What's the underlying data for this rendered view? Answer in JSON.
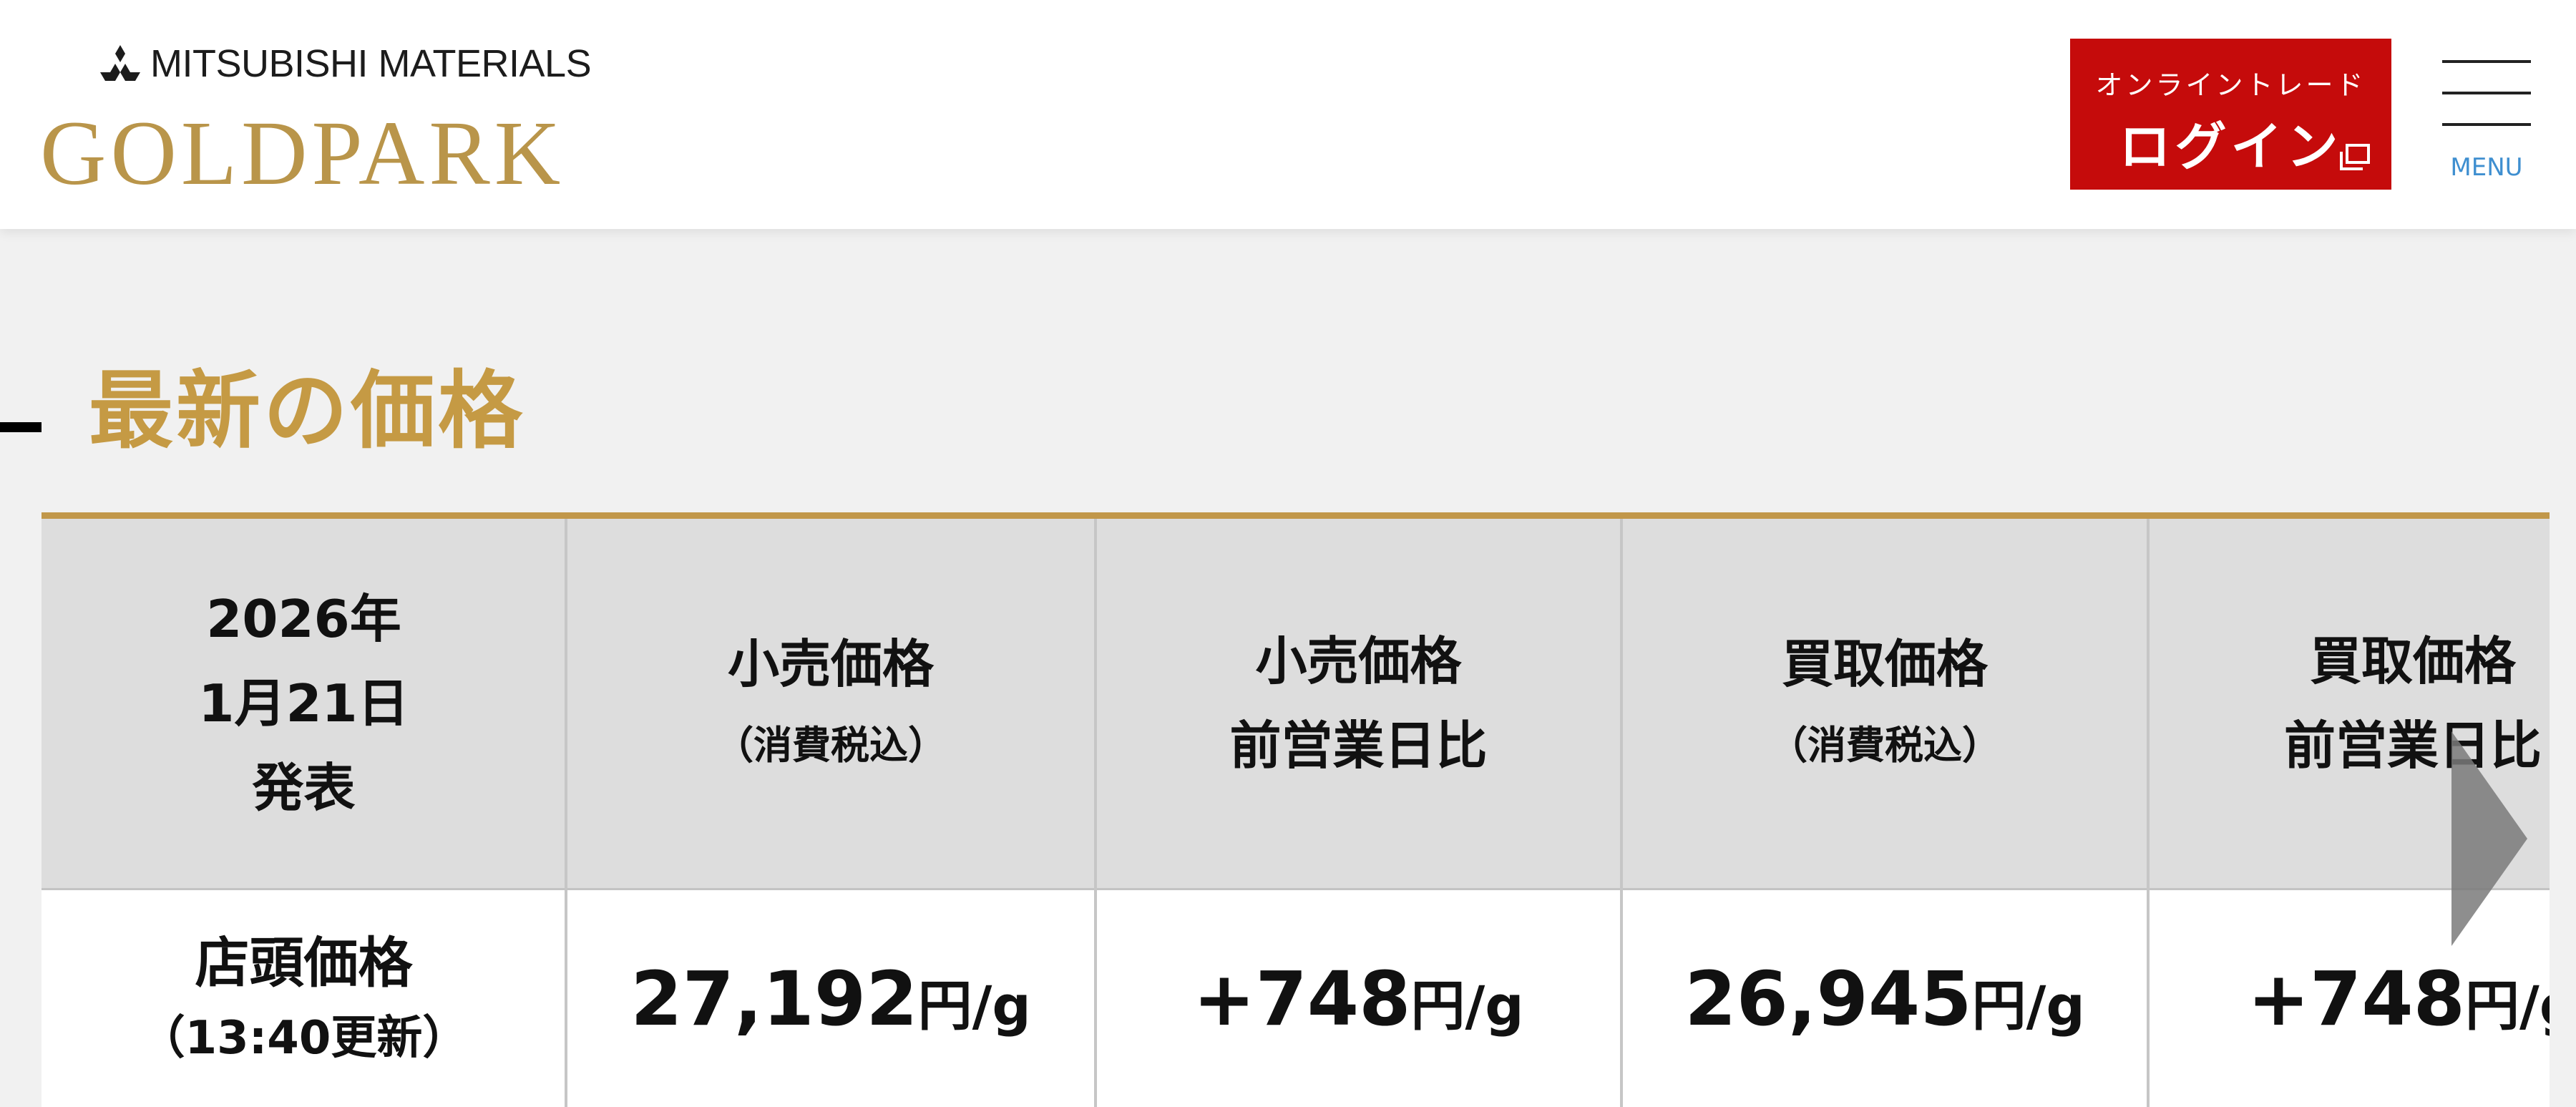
{
  "header": {
    "brand_top": "MITSUBISHI MATERIALS",
    "brand_main": "GOLDPARK",
    "login": {
      "sub_label": "オンライントレード",
      "label": "ログイン"
    },
    "menu_label": "MENU"
  },
  "section_title": "最新の価格",
  "table": {
    "date_lines": [
      "2026年",
      "1月21日",
      "発表"
    ],
    "columns": [
      {
        "line1": "小売価格",
        "line2": "（消費税込）"
      },
      {
        "line1": "小売価格",
        "line2": "前営業日比"
      },
      {
        "line1": "買取価格",
        "line2": "（消費税込）"
      },
      {
        "line1": "買取価格",
        "line2": "前営業日比"
      }
    ],
    "row": {
      "label": "店頭価格",
      "sub_label": "（13:40更新）",
      "values": [
        {
          "num": "27,192",
          "unit": "円/g"
        },
        {
          "num": "+748",
          "unit": "円/g"
        },
        {
          "num": "26,945",
          "unit": "円/g"
        },
        {
          "num": "+748",
          "unit": "円/g"
        }
      ]
    }
  },
  "colors": {
    "gold": "#c59a44",
    "login_red": "#c50b0b",
    "menu_blue": "#3f8fd0"
  },
  "icons": [
    "mitsubishi-logo-icon",
    "external-window-icon",
    "hamburger-menu-icon",
    "scroll-right-arrow-icon"
  ]
}
